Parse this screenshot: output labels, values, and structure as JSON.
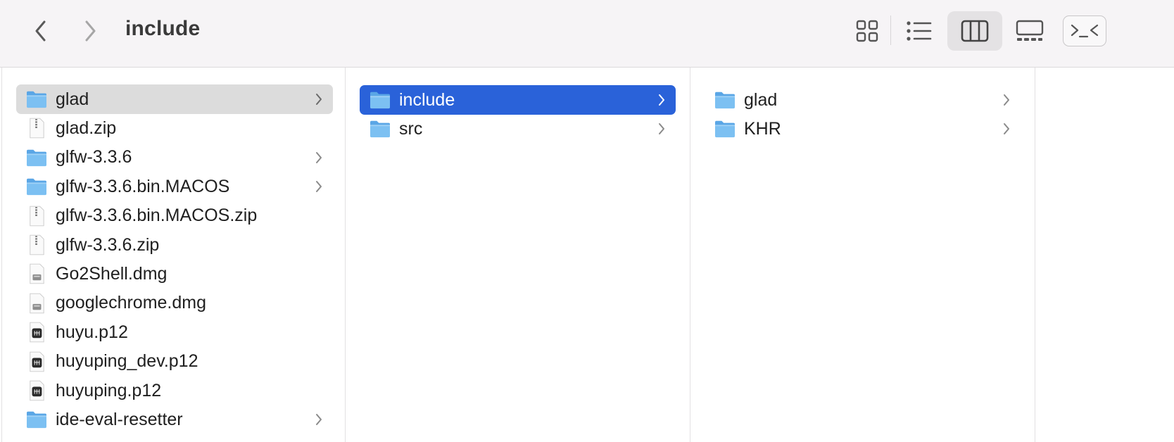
{
  "window": {
    "title": "include"
  },
  "toolbar": {
    "back_icon": "chevron-left-icon",
    "forward_icon": "chevron-right-icon",
    "views": [
      "icon-view-icon",
      "list-view-icon",
      "column-view-icon",
      "gallery-view-icon"
    ],
    "active_view": "column-view-icon",
    "terminal_icon": "terminal-icon"
  },
  "columns": [
    {
      "items": [
        {
          "label": "glad",
          "type": "folder",
          "selected": true,
          "has_children": true
        },
        {
          "label": "glad.zip",
          "type": "zip"
        },
        {
          "label": "glfw-3.3.6",
          "type": "folder",
          "has_children": true
        },
        {
          "label": "glfw-3.3.6.bin.MACOS",
          "type": "folder",
          "has_children": true
        },
        {
          "label": "glfw-3.3.6.bin.MACOS.zip",
          "type": "zip"
        },
        {
          "label": "glfw-3.3.6.zip",
          "type": "zip"
        },
        {
          "label": "Go2Shell.dmg",
          "type": "dmg"
        },
        {
          "label": "googlechrome.dmg",
          "type": "dmg"
        },
        {
          "label": "huyu.p12",
          "type": "cert"
        },
        {
          "label": "huyuping_dev.p12",
          "type": "cert"
        },
        {
          "label": "huyuping.p12",
          "type": "cert"
        },
        {
          "label": "ide-eval-resetter",
          "type": "folder",
          "has_children": true
        }
      ]
    },
    {
      "items": [
        {
          "label": "include",
          "type": "folder",
          "selected": true,
          "has_children": true
        },
        {
          "label": "src",
          "type": "folder",
          "has_children": true
        }
      ]
    },
    {
      "items": [
        {
          "label": "glad",
          "type": "folder",
          "has_children": true
        },
        {
          "label": "KHR",
          "type": "folder",
          "has_children": true
        }
      ]
    }
  ],
  "colors": {
    "selection_active": "#2a62d9",
    "selection_inactive": "#dcdcdc",
    "folder": "#6fb4ef",
    "toolbar_bg": "#f6f4f6"
  }
}
